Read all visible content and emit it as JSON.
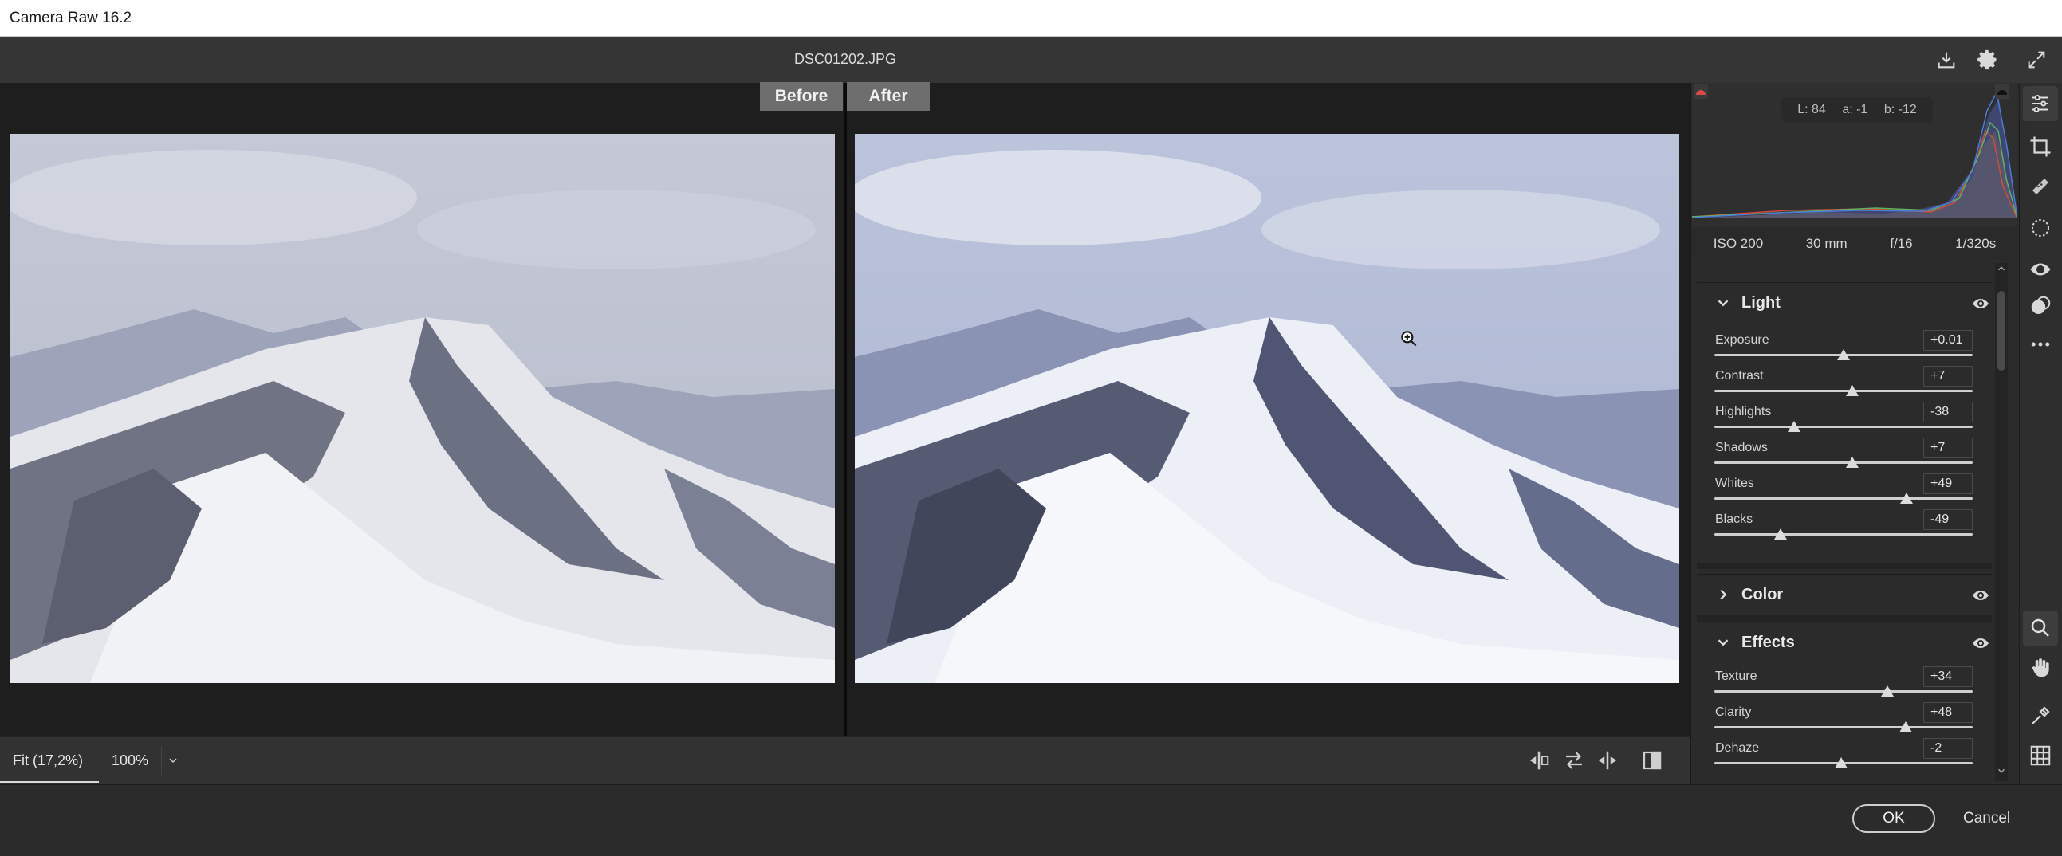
{
  "window": {
    "title": "Camera Raw 16.2"
  },
  "header": {
    "filename": "DSC01202.JPG"
  },
  "compare": {
    "before_label": "Before",
    "after_label": "After"
  },
  "zoom": {
    "fit_label": "Fit (17,2%)",
    "percent_label": "100%"
  },
  "histogram": {
    "readout": {
      "l": "L: 84",
      "a": "a: -1",
      "b": "b: -12"
    },
    "exif": {
      "iso": "ISO 200",
      "focal": "30 mm",
      "aperture": "f/16",
      "shutter": "1/320s"
    }
  },
  "panel": {
    "light": {
      "title": "Light",
      "sliders": [
        {
          "label": "Exposure",
          "value": "+0.01",
          "level": 0.5005
        },
        {
          "label": "Contrast",
          "value": "+7",
          "level": 0.535
        },
        {
          "label": "Highlights",
          "value": "-38",
          "level": 0.31
        },
        {
          "label": "Shadows",
          "value": "+7",
          "level": 0.535
        },
        {
          "label": "Whites",
          "value": "+49",
          "level": 0.745
        },
        {
          "label": "Blacks",
          "value": "-49",
          "level": 0.255
        }
      ]
    },
    "color": {
      "title": "Color"
    },
    "effects": {
      "title": "Effects",
      "sliders": [
        {
          "label": "Texture",
          "value": "+34",
          "level": 0.67
        },
        {
          "label": "Clarity",
          "value": "+48",
          "level": 0.74
        },
        {
          "label": "Dehaze",
          "value": "-2",
          "level": 0.49
        }
      ]
    }
  },
  "footer": {
    "ok_label": "OK",
    "cancel_label": "Cancel"
  },
  "colors": {
    "background": "#2b2b2b",
    "viewer": "#1e1e1e",
    "before_after_tab": "#6e6e6e",
    "slider_track": "#cfcfcf"
  }
}
